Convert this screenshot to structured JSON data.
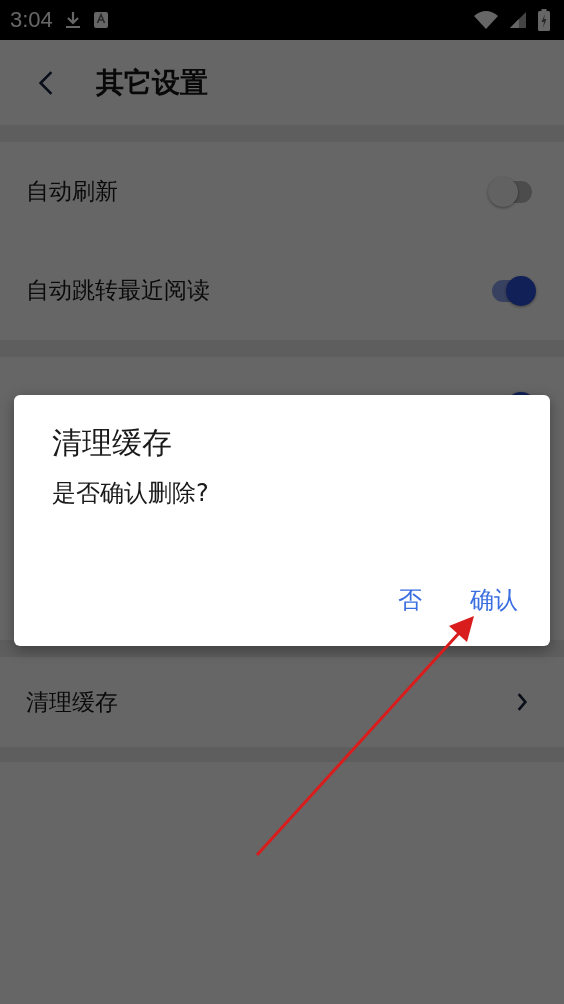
{
  "status_bar": {
    "time": "3:04"
  },
  "header": {
    "title": "其它设置"
  },
  "groups": [
    {
      "items": [
        {
          "kind": "switch",
          "label": "自动刷新",
          "on": false
        },
        {
          "kind": "switch",
          "label": "自动跳转最近阅读",
          "on": true
        }
      ]
    },
    {
      "items": [
        {
          "kind": "switch",
          "on": true
        }
      ]
    },
    {
      "items": [
        {
          "kind": "link",
          "label": "清理缓存"
        }
      ]
    }
  ],
  "dialog": {
    "title": "清理缓存",
    "message": "是否确认删除?",
    "buttons": [
      "否",
      "确认"
    ]
  }
}
